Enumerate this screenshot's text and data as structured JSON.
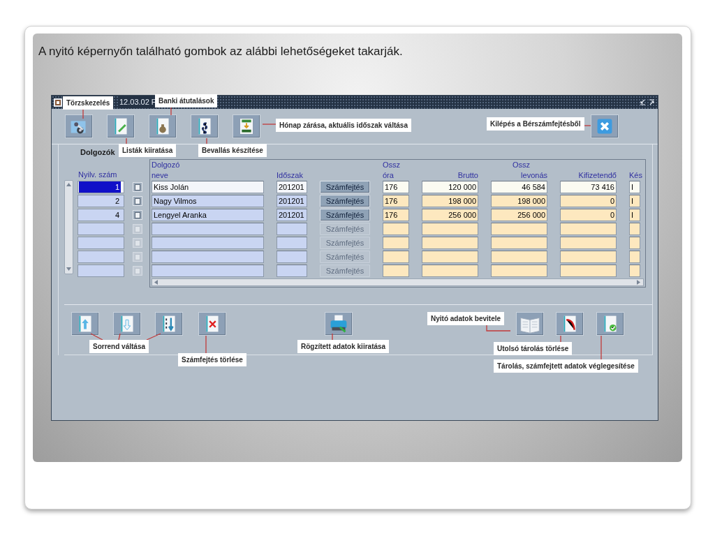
{
  "slide_title": "A nyitó képernyőn található gombok az alábbi lehetőségeket takarják.",
  "window": {
    "title": "12.03.02 F"
  },
  "section_label": "Dolgozók",
  "columns": {
    "nyilv": "Nyilv. szám",
    "name_1": "Dolgozó",
    "name_2": "neve",
    "period": "Időszak",
    "hours_1": "Ossz",
    "hours_2": "óra",
    "gross": "Brutto",
    "deductions_1": "Ossz",
    "deductions_2": "levonás",
    "payable": "Kifizetendő",
    "done": "Kés"
  },
  "rows": [
    {
      "nyilv": "1",
      "name": "Kiss Jolán",
      "period": "201201",
      "button": "Számfejtés",
      "hours": "176",
      "gross": "120 000",
      "deductions": "46 584",
      "payable": "73 416",
      "done": "I",
      "selected": true,
      "disabled": false
    },
    {
      "nyilv": "2",
      "name": "Nagy Vilmos",
      "period": "201201",
      "button": "Számfejtés",
      "hours": "176",
      "gross": "198 000",
      "deductions": "198 000",
      "payable": "0",
      "done": "I",
      "selected": false,
      "disabled": false
    },
    {
      "nyilv": "4",
      "name": "Lengyel Aranka",
      "period": "201201",
      "button": "Számfejtés",
      "hours": "176",
      "gross": "256 000",
      "deductions": "256 000",
      "payable": "0",
      "done": "I",
      "selected": false,
      "disabled": false
    },
    {
      "button": "Számfejtés",
      "selected": false,
      "disabled": true
    },
    {
      "button": "Számfejtés",
      "selected": false,
      "disabled": true
    },
    {
      "button": "Számfejtés",
      "selected": false,
      "disabled": true
    },
    {
      "button": "Számfejtés",
      "selected": false,
      "disabled": true
    }
  ],
  "callouts": [
    {
      "text": "Törzskezelés"
    },
    {
      "text": "Banki átutalások"
    },
    {
      "text": "Listák kiiratása"
    },
    {
      "text": "Bevallás készítése"
    },
    {
      "text": "Hónap zárása, aktuális időszak váltása"
    },
    {
      "text": "Kilépés a Bérszámfejtésből"
    },
    {
      "text": "Sorrend váltása"
    },
    {
      "text": "Számfejtés törlése"
    },
    {
      "text": "Rögzített adatok kiiratása"
    },
    {
      "text": "Nyitó adatok bevitele"
    },
    {
      "text": "Utolsó tárolás törlése"
    },
    {
      "text": "Tárolás, számfejtett adatok véglegesítése"
    }
  ]
}
